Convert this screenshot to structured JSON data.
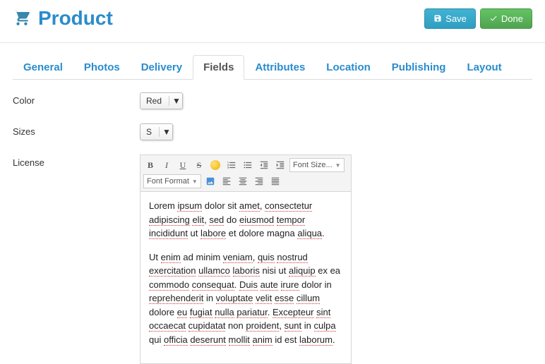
{
  "header": {
    "title": "Product",
    "save_label": "Save",
    "done_label": "Done"
  },
  "tabs": [
    {
      "label": "General"
    },
    {
      "label": "Photos"
    },
    {
      "label": "Delivery"
    },
    {
      "label": "Fields"
    },
    {
      "label": "Attributes"
    },
    {
      "label": "Location"
    },
    {
      "label": "Publishing"
    },
    {
      "label": "Layout"
    }
  ],
  "active_tab": "Fields",
  "fields": {
    "color": {
      "label": "Color",
      "value": "Red"
    },
    "sizes": {
      "label": "Sizes",
      "value": "S"
    },
    "license": {
      "label": "License"
    }
  },
  "editor": {
    "font_size_label": "Font Size...",
    "font_format_label": "Font Format",
    "paragraphs": [
      [
        {
          "t": "Lorem ",
          "s": 0
        },
        {
          "t": "ipsum",
          "s": 1
        },
        {
          "t": " dolor sit ",
          "s": 0
        },
        {
          "t": "amet",
          "s": 1
        },
        {
          "t": ", ",
          "s": 0
        },
        {
          "t": "consectetur",
          "s": 1
        },
        {
          "t": " ",
          "s": 0
        },
        {
          "t": "adipiscing",
          "s": 1
        },
        {
          "t": " ",
          "s": 0
        },
        {
          "t": "elit",
          "s": 1
        },
        {
          "t": ", ",
          "s": 0
        },
        {
          "t": "sed",
          "s": 1
        },
        {
          "t": " do ",
          "s": 0
        },
        {
          "t": "eiusmod",
          "s": 1
        },
        {
          "t": " ",
          "s": 0
        },
        {
          "t": "tempor",
          "s": 1
        },
        {
          "t": " ",
          "s": 0
        },
        {
          "t": "incididunt",
          "s": 1
        },
        {
          "t": " ut ",
          "s": 0
        },
        {
          "t": "labore",
          "s": 1
        },
        {
          "t": " et dolore magna ",
          "s": 0
        },
        {
          "t": "aliqua",
          "s": 1
        },
        {
          "t": ".",
          "s": 0
        }
      ],
      [
        {
          "t": "Ut ",
          "s": 0
        },
        {
          "t": "enim",
          "s": 1
        },
        {
          "t": " ad minim ",
          "s": 0
        },
        {
          "t": "veniam",
          "s": 1
        },
        {
          "t": ", ",
          "s": 0
        },
        {
          "t": "quis",
          "s": 1
        },
        {
          "t": " ",
          "s": 0
        },
        {
          "t": "nostrud",
          "s": 1
        },
        {
          "t": " ",
          "s": 0
        },
        {
          "t": "exercitation",
          "s": 1
        },
        {
          "t": " ",
          "s": 0
        },
        {
          "t": "ullamco",
          "s": 1
        },
        {
          "t": " ",
          "s": 0
        },
        {
          "t": "laboris",
          "s": 1
        },
        {
          "t": " nisi ut ",
          "s": 0
        },
        {
          "t": "aliquip",
          "s": 1
        },
        {
          "t": " ex ea ",
          "s": 0
        },
        {
          "t": "commodo",
          "s": 1
        },
        {
          "t": " ",
          "s": 0
        },
        {
          "t": "consequat",
          "s": 1
        },
        {
          "t": ". ",
          "s": 0
        },
        {
          "t": "Duis",
          "s": 1
        },
        {
          "t": " ",
          "s": 0
        },
        {
          "t": "aute",
          "s": 1
        },
        {
          "t": " ",
          "s": 0
        },
        {
          "t": "irure",
          "s": 1
        },
        {
          "t": " dolor in ",
          "s": 0
        },
        {
          "t": "reprehenderit",
          "s": 1
        },
        {
          "t": " in ",
          "s": 0
        },
        {
          "t": "voluptate",
          "s": 1
        },
        {
          "t": " ",
          "s": 0
        },
        {
          "t": "velit",
          "s": 1
        },
        {
          "t": " ",
          "s": 0
        },
        {
          "t": "esse",
          "s": 1
        },
        {
          "t": " ",
          "s": 0
        },
        {
          "t": "cillum",
          "s": 1
        },
        {
          "t": " dolore ",
          "s": 0
        },
        {
          "t": "eu",
          "s": 1
        },
        {
          "t": " ",
          "s": 0
        },
        {
          "t": "fugiat",
          "s": 1
        },
        {
          "t": " ",
          "s": 0
        },
        {
          "t": "nulla",
          "s": 1
        },
        {
          "t": " ",
          "s": 0
        },
        {
          "t": "pariatur",
          "s": 1
        },
        {
          "t": ". ",
          "s": 0
        },
        {
          "t": "Excepteur",
          "s": 1
        },
        {
          "t": " ",
          "s": 0
        },
        {
          "t": "sint",
          "s": 1
        },
        {
          "t": " ",
          "s": 0
        },
        {
          "t": "occaecat",
          "s": 1
        },
        {
          "t": " ",
          "s": 0
        },
        {
          "t": "cupidatat",
          "s": 1
        },
        {
          "t": " non ",
          "s": 0
        },
        {
          "t": "proident",
          "s": 1
        },
        {
          "t": ", ",
          "s": 0
        },
        {
          "t": "sunt",
          "s": 1
        },
        {
          "t": " in ",
          "s": 0
        },
        {
          "t": "culpa",
          "s": 1
        },
        {
          "t": " qui ",
          "s": 0
        },
        {
          "t": "officia",
          "s": 1
        },
        {
          "t": " ",
          "s": 0
        },
        {
          "t": "deserunt",
          "s": 1
        },
        {
          "t": " ",
          "s": 0
        },
        {
          "t": "mollit",
          "s": 1
        },
        {
          "t": " ",
          "s": 0
        },
        {
          "t": "anim",
          "s": 1
        },
        {
          "t": " id est ",
          "s": 0
        },
        {
          "t": "laborum",
          "s": 1
        },
        {
          "t": ".",
          "s": 0
        }
      ]
    ]
  }
}
